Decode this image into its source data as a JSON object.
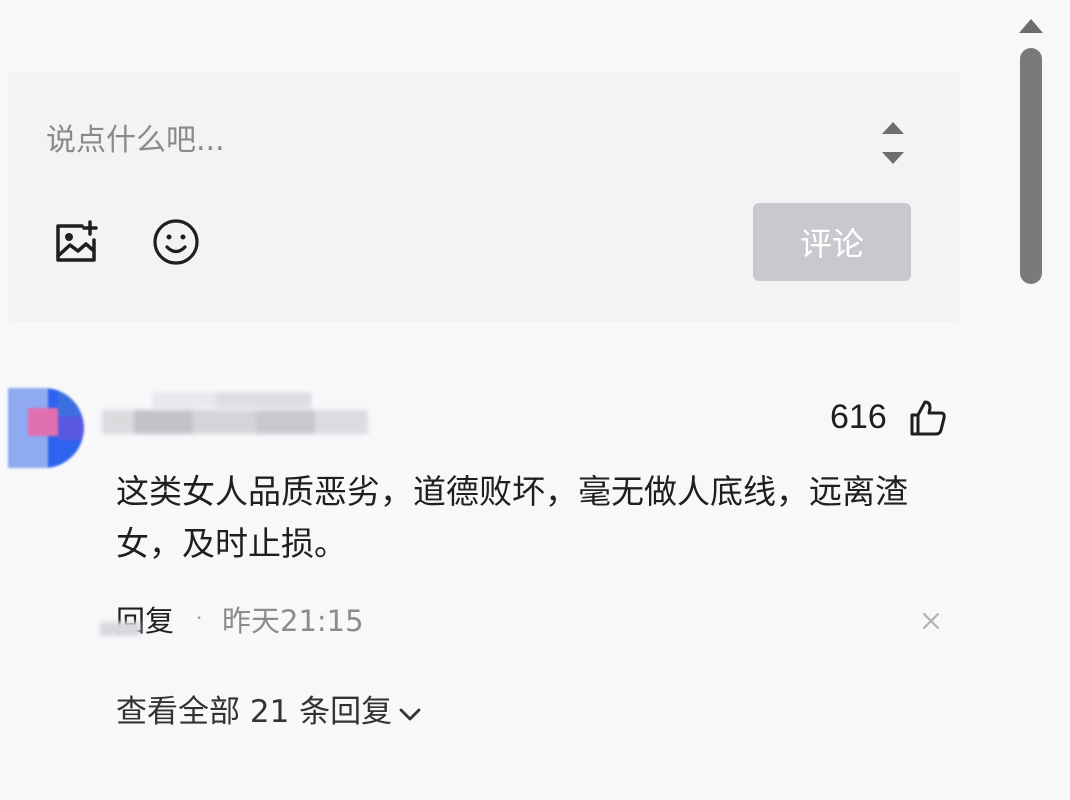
{
  "composer": {
    "placeholder": "说点什么吧...",
    "submit_label": "评论",
    "submit_color": "#c8c9cc",
    "icons": [
      "image-upload-icon",
      "emoji-icon",
      "spinner-arrows-icon"
    ]
  },
  "comment": {
    "like_count": "616",
    "text": "这类女人品质恶劣，道德败坏，毫无做人底线，远离渣女，及时止损。",
    "reply_label": "回复",
    "separator": "·",
    "timestamp": "昨天21:15",
    "view_all_replies": "查看全部 21 条回复"
  },
  "colors": {
    "background": "#f7f8fa",
    "composer_background": "#f2f3f5",
    "text": "#1f1f1f",
    "muted_text": "#8c8c8c"
  }
}
